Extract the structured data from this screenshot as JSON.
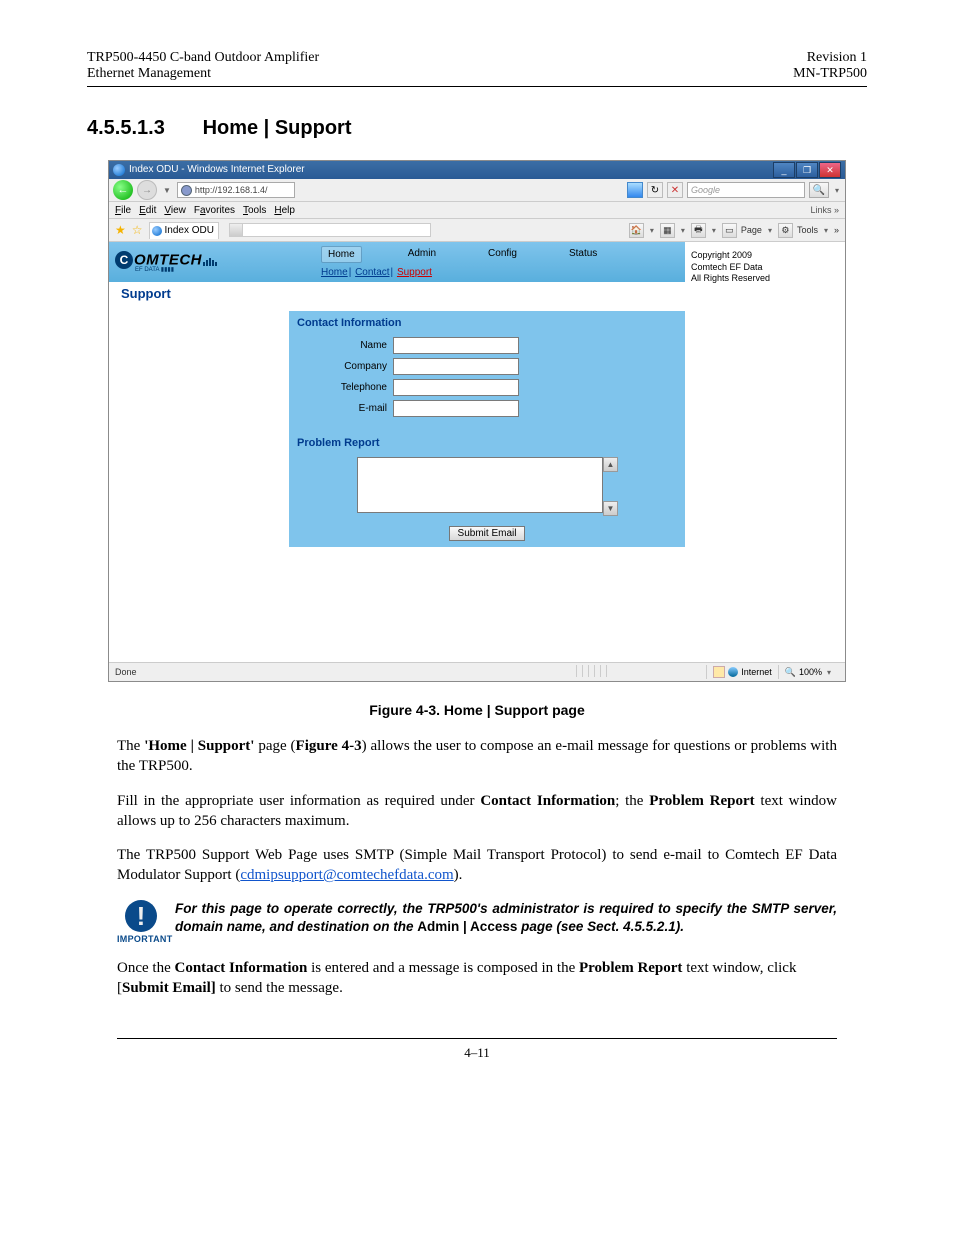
{
  "docHeader": {
    "leftLine1": "TRP500-4450 C-band Outdoor Amplifier",
    "leftLine2": "Ethernet Management",
    "rightLine1": "Revision 1",
    "rightLine2": "MN-TRP500"
  },
  "section": {
    "num": "4.5.5.1.3",
    "title": "Home | Support"
  },
  "ie": {
    "title": "Index ODU - Windows Internet Explorer",
    "address": "http://192.168.1.4/",
    "searchPlaceholder": "Google",
    "menubar": {
      "file": "File",
      "edit": "Edit",
      "view": "View",
      "favorites": "Favorites",
      "tools": "Tools",
      "help": "Help",
      "links": "Links"
    },
    "favtab": "Index ODU",
    "toolbar": {
      "page": "Page",
      "tools": "Tools"
    },
    "status": {
      "done": "Done",
      "zone": "Internet",
      "zoom": "100%"
    }
  },
  "app": {
    "logo": {
      "brand": "OMTECH",
      "sub": "EF DATA"
    },
    "tabs": {
      "home": "Home",
      "admin": "Admin",
      "config": "Config",
      "status": "Status"
    },
    "crumbs": {
      "home": "Home",
      "contact": "Contact",
      "support": "Support"
    },
    "pageTitle": "Support",
    "contactHeading": "Contact Information",
    "labels": {
      "name": "Name",
      "company": "Company",
      "telephone": "Telephone",
      "email": "E-mail"
    },
    "values": {
      "name": "",
      "company": "",
      "telephone": "",
      "email": "",
      "report": ""
    },
    "problemHeading": "Problem Report",
    "submit": "Submit Email",
    "copyright": {
      "l1": "Copyright 2009",
      "l2": "Comtech EF Data",
      "l3": "All Rights Reserved"
    }
  },
  "figureCaption": "Figure 4-3. Home | Support page",
  "para1": {
    "a": "The ",
    "b": "'Home | Support'",
    "c": " page (",
    "d": "Figure 4-3",
    "e": ") allows the user to compose an e-mail message for questions or problems with the TRP500."
  },
  "para2": {
    "a": "Fill in the appropriate user information as required under ",
    "b": "Contact Information",
    "c": "; the ",
    "d": "Problem Report",
    "e": " text window allows up to 256 characters maximum."
  },
  "para3": {
    "a": "The TRP500 Support Web Page uses SMTP (Simple Mail Transport Protocol) to send e-mail to Comtech EF Data Modulator Support (",
    "link": "cdmipsupport@comtechefdata.com",
    "b": ")."
  },
  "note": {
    "iconLabel": "IMPORTANT",
    "a": "For this page to operate correctly, the TRP500's administrator is required to specify the SMTP server, domain name, and destination on the ",
    "b": "Admin | Access",
    "c": " page (see Sect. 4.5.5.2.1)."
  },
  "para4": {
    "a": "Once the ",
    "b": "Contact Information",
    "c": " is entered and a message is composed in the ",
    "d": "Problem Report",
    "e": " text window, click  [",
    "f": "Submit Email]",
    "g": " to send the message."
  },
  "footer": "4–11"
}
